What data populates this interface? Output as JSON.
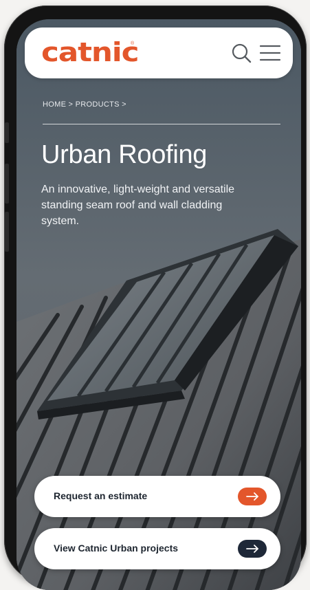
{
  "header": {
    "logo_text": "catnic",
    "logo_mark": "®",
    "logo_color": "#e3562b",
    "search_icon": "search-icon",
    "menu_icon": "hamburger-menu-icon"
  },
  "breadcrumb": {
    "text": "HOME > PRODUCTS >"
  },
  "hero": {
    "title": "Urban Roofing",
    "description": "An innovative, light-weight and versatile standing seam roof and wall cladding system."
  },
  "actions": {
    "primary": {
      "label": "Request an estimate",
      "icon": "arrow-right-icon",
      "accent": "#e3562b"
    },
    "secondary": {
      "label": "View Catnic Urban projects",
      "icon": "arrow-right-icon",
      "accent": "#1e2838"
    }
  }
}
